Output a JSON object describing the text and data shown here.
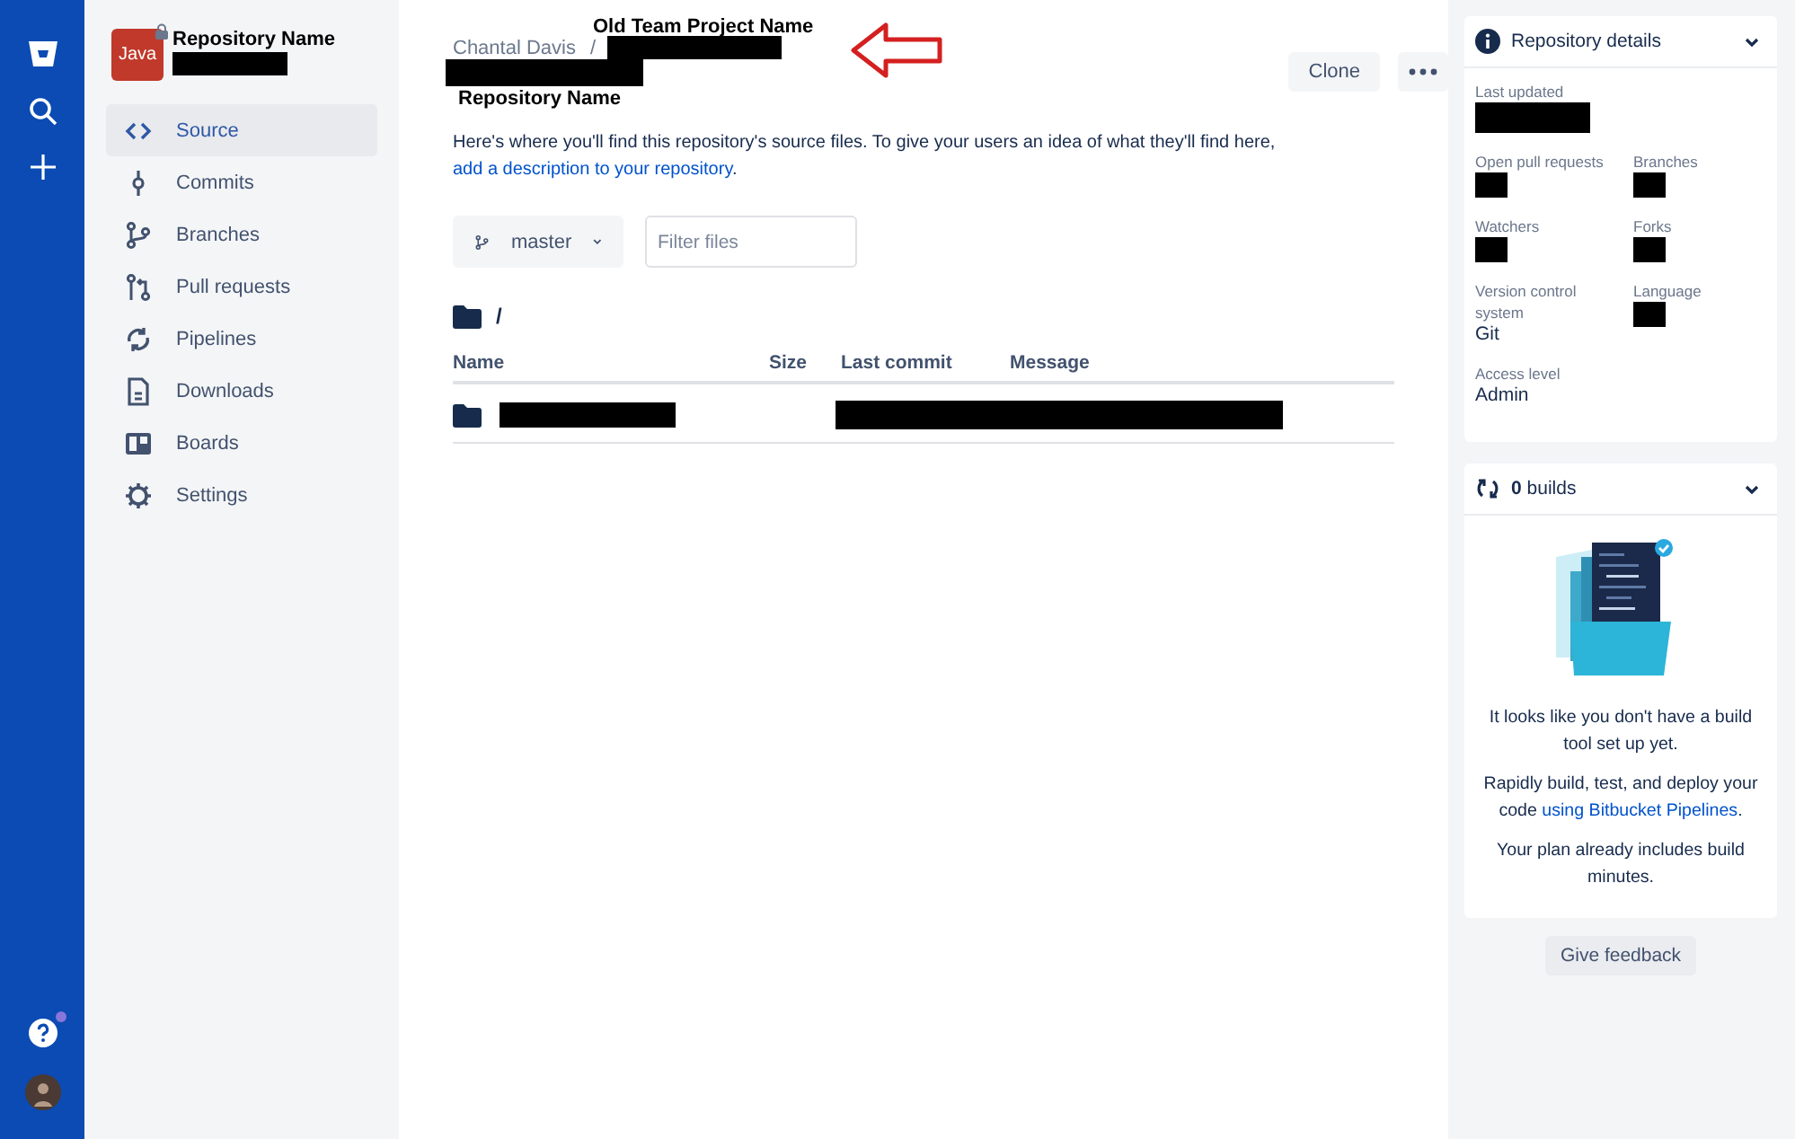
{
  "repository": {
    "avatar_label": "Java",
    "name": "Repository Name",
    "private": true,
    "name_redacted": true
  },
  "sidebar": {
    "items": [
      {
        "label": "Source",
        "kind": "code",
        "selected": true
      },
      {
        "label": "Commits",
        "kind": "commit",
        "selected": false
      },
      {
        "label": "Branches",
        "kind": "branch",
        "selected": false
      },
      {
        "label": "Pull requests",
        "kind": "pull",
        "selected": false
      },
      {
        "label": "Pipelines",
        "kind": "pipelines",
        "selected": false
      },
      {
        "label": "Downloads",
        "kind": "download",
        "selected": false
      },
      {
        "label": "Boards",
        "kind": "boards",
        "selected": false
      },
      {
        "label": "Settings",
        "kind": "settings",
        "selected": false
      }
    ]
  },
  "help": {
    "notification": true
  },
  "header": {
    "breadcrumb": {
      "owner": "Chantal Davis",
      "separator": "/",
      "project_redacted": true
    },
    "annotation": {
      "label": "Old Team Project Name"
    },
    "title_redacted": true,
    "title": "Repository Name",
    "buttons": [
      {
        "label": "Clone",
        "kind": "text"
      },
      {
        "kind": "more"
      }
    ]
  },
  "description": {
    "text": "Here's where you'll find this repository's source files. To give your users an idea of what they'll find here, ",
    "link": "add a description to your repository",
    "end": "."
  },
  "toolbar": {
    "branch": "master",
    "filter": {
      "placeholder": "Filter files"
    }
  },
  "path": "/",
  "table": {
    "columns": [
      "Name",
      "Size",
      "Last commit",
      "Message"
    ],
    "rows": [
      {
        "kind": "folder",
        "name_redacted": true,
        "commit_redacted": true
      }
    ]
  },
  "details": {
    "title": "Repository details",
    "expanded": true,
    "fields": [
      {
        "label": "Last updated",
        "redacted": true
      },
      {
        "label": "Open pull requests",
        "redacted": true
      },
      {
        "label": "Branches",
        "redacted": true
      },
      {
        "label": "Watchers",
        "redacted": true
      },
      {
        "label": "Forks",
        "redacted": true
      },
      {
        "label": "Version control system",
        "value": "Git"
      },
      {
        "label": "Language",
        "redacted": true
      },
      {
        "label": "Access level",
        "value": "Admin"
      }
    ]
  },
  "builds": {
    "count": "0",
    "label": "builds",
    "messages": [
      {
        "text": "It looks like you don't have a build tool set up yet."
      },
      {
        "text": "Rapidly build, test, and deploy your code ",
        "link": "using Bitbucket Pipelines",
        "end": "."
      },
      {
        "text": "Your plan already includes build minutes."
      }
    ]
  },
  "feedback_button": "Give feedback"
}
